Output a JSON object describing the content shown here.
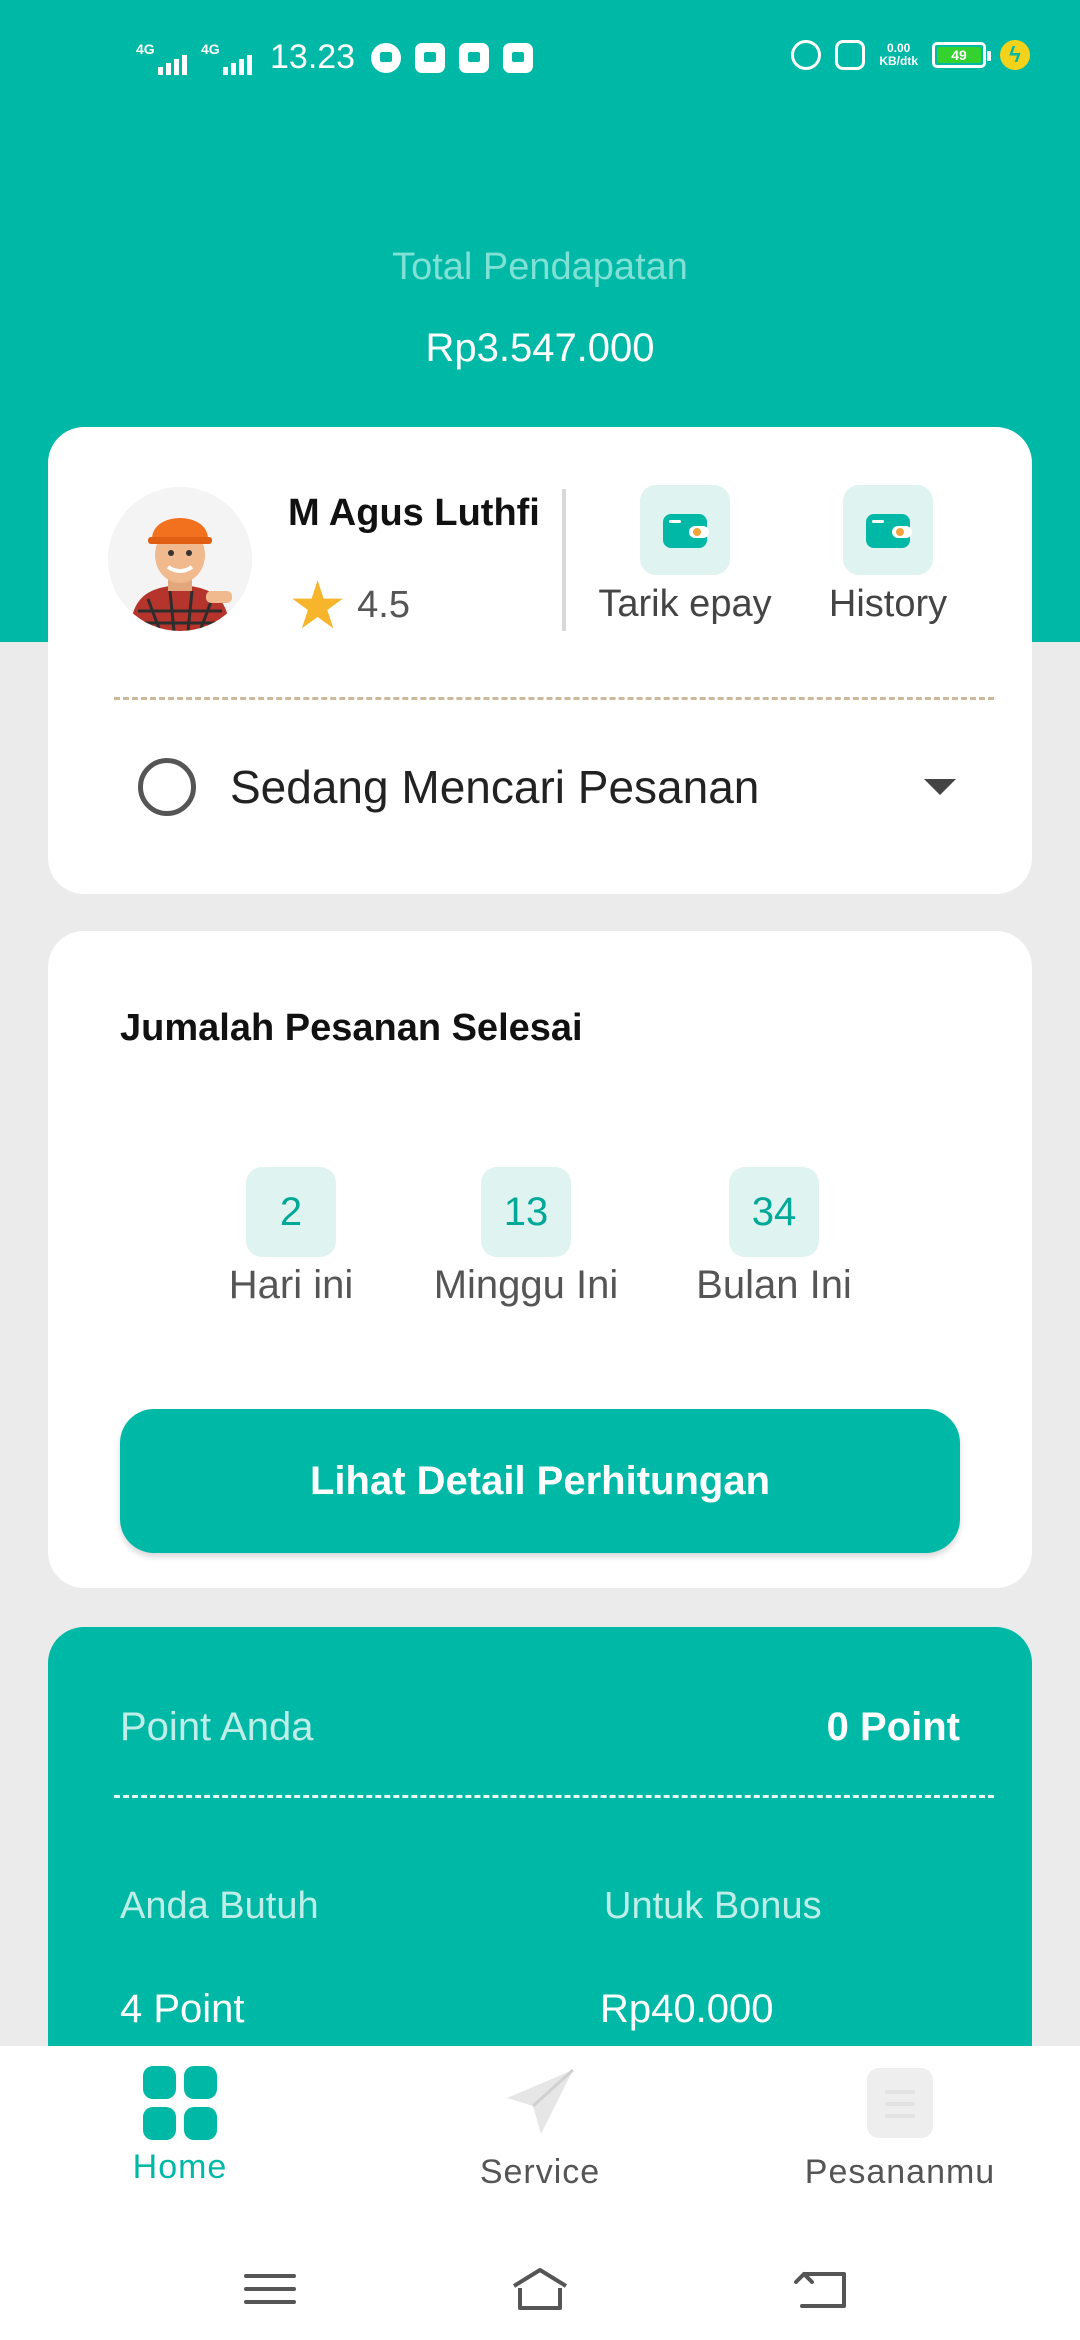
{
  "status_bar": {
    "network_1": "4G",
    "network_2": "4G",
    "time": "13.23",
    "speed_value": "0.00",
    "speed_unit": "KB/dtk",
    "battery": "49"
  },
  "earnings": {
    "label": "Total Pendapatan",
    "value": "Rp3.547.000"
  },
  "driver": {
    "name": "M Agus Luthfi",
    "rating": "4.5"
  },
  "actions": {
    "withdraw_label": "Tarik epay",
    "history_label": "History"
  },
  "status": {
    "text": "Sedang Mencari Pesanan"
  },
  "orders": {
    "title": "Jumalah Pesanan Selesai",
    "today_count": "2",
    "today_label": "Hari ini",
    "week_count": "13",
    "week_label": "Minggu Ini",
    "month_count": "34",
    "month_label": "Bulan Ini",
    "detail_button": "Lihat Detail Perhitungan"
  },
  "points": {
    "label": "Point Anda",
    "value": "0 Point",
    "need_label": "Anda Butuh",
    "need_value": "4 Point",
    "bonus_label": "Untuk Bonus",
    "bonus_value": "Rp40.000"
  },
  "nav": {
    "home": "Home",
    "service": "Service",
    "orders": "Pesananmu"
  },
  "colors": {
    "accent": "#00b8a6",
    "accent_light": "#dff3f0",
    "star": "#f7b52c"
  }
}
